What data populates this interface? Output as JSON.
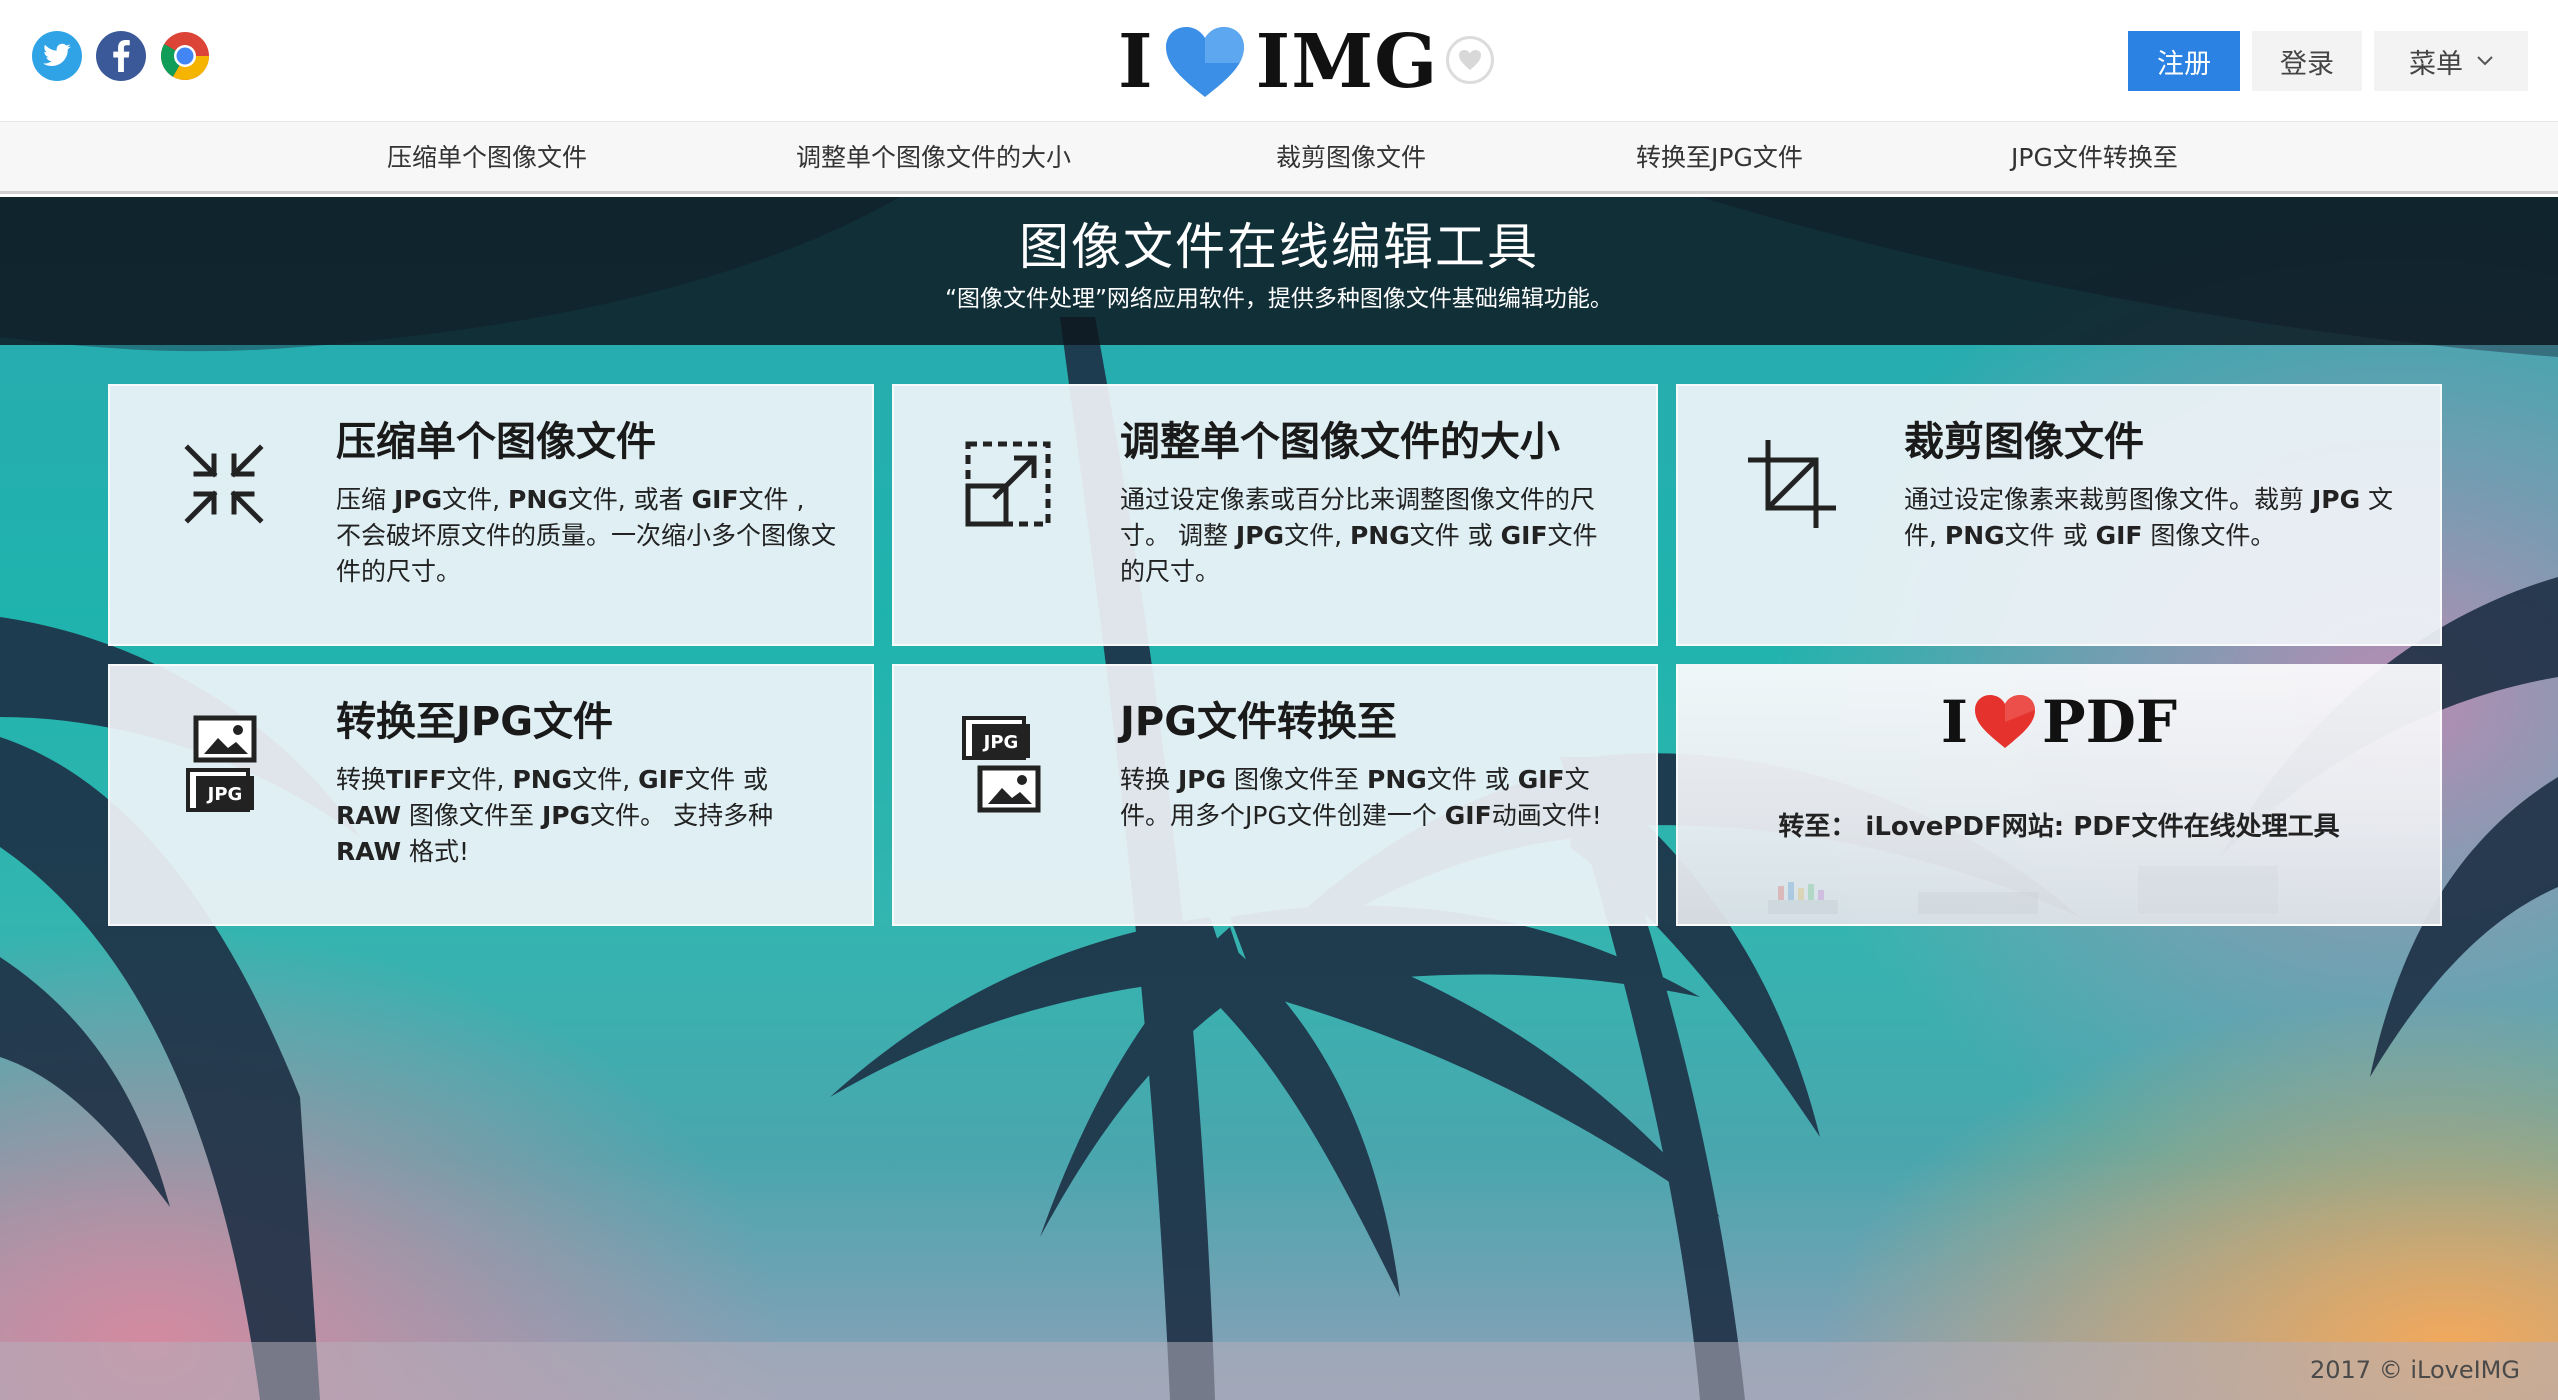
{
  "header": {
    "social": [
      {
        "name": "twitter-icon",
        "color": "#2fa3e6"
      },
      {
        "name": "facebook-icon",
        "color": "#3b5998"
      },
      {
        "name": "chrome-icon",
        "color": "#ffffff"
      }
    ],
    "logo_left": "I",
    "logo_right": "IMG",
    "logo_heart_color": "#2b82e2",
    "register_label": "注册",
    "login_label": "登录",
    "menu_label": "菜单"
  },
  "nav": {
    "items": [
      {
        "label": "压缩单个图像文件"
      },
      {
        "label": "调整单个图像文件的大小"
      },
      {
        "label": "裁剪图像文件"
      },
      {
        "label": "转换至JPG文件"
      },
      {
        "label": "JPG文件转换至"
      }
    ]
  },
  "hero": {
    "title": "图像文件在线编辑工具",
    "subtitle": "“图像文件处理”网络应用软件，提供多种图像文件基础编辑功能。"
  },
  "tools": [
    {
      "title": "压缩单个图像文件",
      "desc_parts": [
        "压缩 ",
        "JPG",
        "文件, ",
        "PNG",
        "文件, 或者 ",
        "GIF",
        "文件 , 不会破坏原文件的质量。一次缩小多个图像文件的尺寸。"
      ],
      "icon": "compress-icon"
    },
    {
      "title": "调整单个图像文件的大小",
      "desc_parts": [
        "通过设定像素或百分比来调整图像文件的尺寸。 调整 ",
        "JPG",
        "文件, ",
        "PNG",
        "文件 或 ",
        "GIF",
        "文件的尺寸。"
      ],
      "icon": "resize-icon"
    },
    {
      "title": "裁剪图像文件",
      "desc_parts": [
        "通过设定像素来裁剪图像文件。裁剪 ",
        "JPG",
        " 文件, ",
        "PNG",
        "文件 或 ",
        "GIF",
        " 图像文件。"
      ],
      "icon": "crop-icon"
    },
    {
      "title": "转换至JPG文件",
      "desc_parts": [
        "转换",
        "TIFF",
        "文件, ",
        "PNG",
        "文件, ",
        "GIF",
        "文件 或 ",
        "RAW",
        " 图像文件至 ",
        "JPG",
        "文件。 支持多种 ",
        "RAW",
        " 格式!"
      ],
      "icon": "image-to-jpg-icon",
      "icon_badge": "JPG"
    },
    {
      "title": "JPG文件转换至",
      "desc_parts": [
        "转换 ",
        "JPG",
        " 图像文件至 ",
        "PNG",
        "文件 或 ",
        "GIF",
        "文件。用多个JPG文件创建一个 ",
        "GIF",
        "动画文件!"
      ],
      "icon": "jpg-to-image-icon",
      "icon_badge": "JPG"
    }
  ],
  "pdf_promo": {
    "logo_left": "I",
    "logo_right": "PDF",
    "heart_color": "#e5322d",
    "caption": "转至： iLovePDF网站: PDF文件在线处理工具"
  },
  "footer": {
    "copyright": "2017 © iLoveIMG"
  }
}
